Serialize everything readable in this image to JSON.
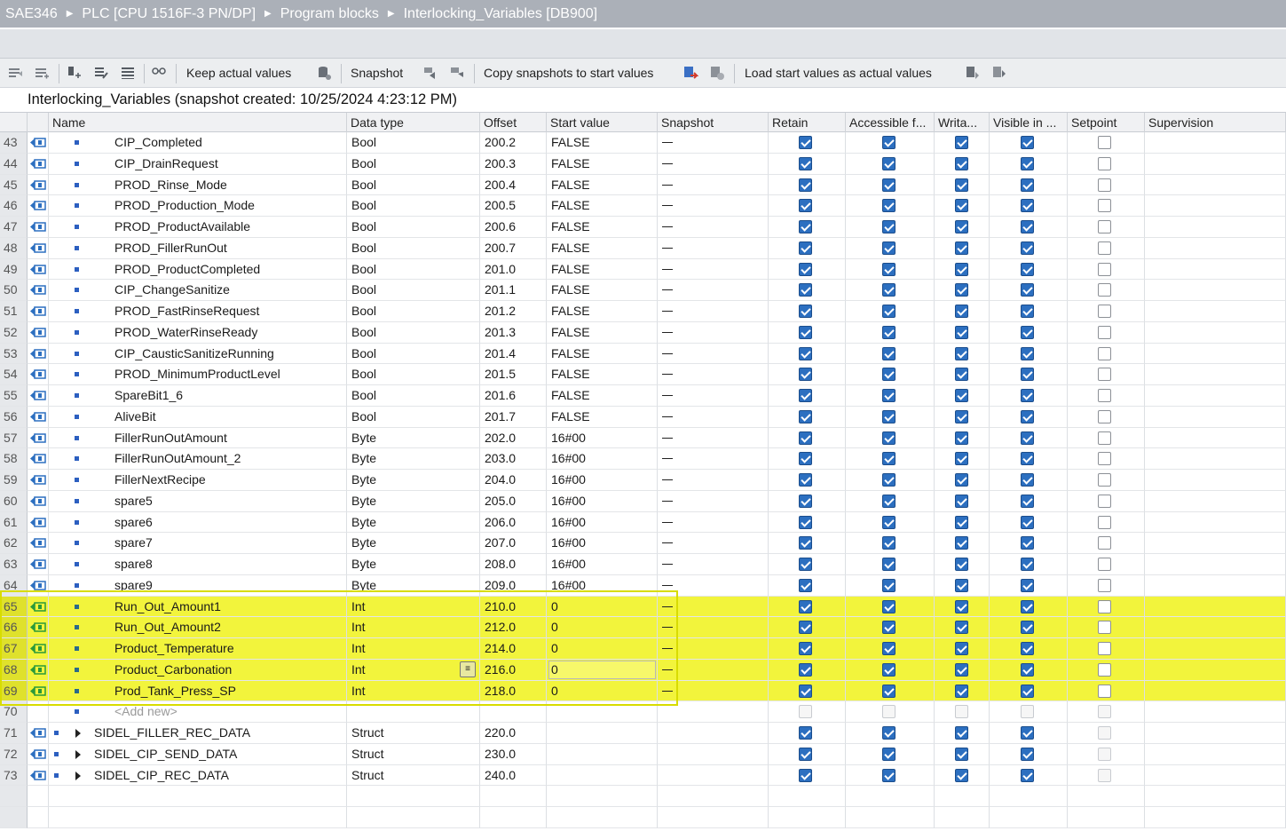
{
  "breadcrumb": [
    "SAE346",
    "PLC [CPU 1516F-3 PN/DP]",
    "Program blocks",
    "Interlocking_Variables [DB900]"
  ],
  "toolbar": {
    "keep_actual_values": "Keep actual values",
    "snapshot": "Snapshot",
    "copy_snapshots": "Copy snapshots to start values",
    "load_start_values": "Load start values as actual values"
  },
  "snapshot_title": "Interlocking_Variables (snapshot created: 10/25/2024 4:23:12 PM)",
  "columns": [
    "Name",
    "Data type",
    "Offset",
    "Start value",
    "Snapshot",
    "Retain",
    "Accessible f...",
    "Writa...",
    "Visible in ...",
    "Setpoint",
    "Supervision"
  ],
  "rows": [
    {
      "n": "43",
      "name": "CIP_Completed",
      "type": "Bool",
      "offset": "200.2",
      "start": "FALSE",
      "snap": "—"
    },
    {
      "n": "44",
      "name": "CIP_DrainRequest",
      "type": "Bool",
      "offset": "200.3",
      "start": "FALSE",
      "snap": "—"
    },
    {
      "n": "45",
      "name": "PROD_Rinse_Mode",
      "type": "Bool",
      "offset": "200.4",
      "start": "FALSE",
      "snap": "—"
    },
    {
      "n": "46",
      "name": "PROD_Production_Mode",
      "type": "Bool",
      "offset": "200.5",
      "start": "FALSE",
      "snap": "—"
    },
    {
      "n": "47",
      "name": "PROD_ProductAvailable",
      "type": "Bool",
      "offset": "200.6",
      "start": "FALSE",
      "snap": "—"
    },
    {
      "n": "48",
      "name": "PROD_FillerRunOut",
      "type": "Bool",
      "offset": "200.7",
      "start": "FALSE",
      "snap": "—"
    },
    {
      "n": "49",
      "name": "PROD_ProductCompleted",
      "type": "Bool",
      "offset": "201.0",
      "start": "FALSE",
      "snap": "—"
    },
    {
      "n": "50",
      "name": "CIP_ChangeSanitize",
      "type": "Bool",
      "offset": "201.1",
      "start": "FALSE",
      "snap": "—"
    },
    {
      "n": "51",
      "name": "PROD_FastRinseRequest",
      "type": "Bool",
      "offset": "201.2",
      "start": "FALSE",
      "snap": "—"
    },
    {
      "n": "52",
      "name": "PROD_WaterRinseReady",
      "type": "Bool",
      "offset": "201.3",
      "start": "FALSE",
      "snap": "—"
    },
    {
      "n": "53",
      "name": "CIP_CausticSanitizeRunning",
      "type": "Bool",
      "offset": "201.4",
      "start": "FALSE",
      "snap": "—"
    },
    {
      "n": "54",
      "name": "PROD_MinimumProductLevel",
      "type": "Bool",
      "offset": "201.5",
      "start": "FALSE",
      "snap": "—"
    },
    {
      "n": "55",
      "name": "SpareBit1_6",
      "type": "Bool",
      "offset": "201.6",
      "start": "FALSE",
      "snap": "—"
    },
    {
      "n": "56",
      "name": "AliveBit",
      "type": "Bool",
      "offset": "201.7",
      "start": "FALSE",
      "snap": "—"
    },
    {
      "n": "57",
      "name": "FillerRunOutAmount",
      "type": "Byte",
      "offset": "202.0",
      "start": "16#00",
      "snap": "—"
    },
    {
      "n": "58",
      "name": "FillerRunOutAmount_2",
      "type": "Byte",
      "offset": "203.0",
      "start": "16#00",
      "snap": "—"
    },
    {
      "n": "59",
      "name": "FillerNextRecipe",
      "type": "Byte",
      "offset": "204.0",
      "start": "16#00",
      "snap": "—"
    },
    {
      "n": "60",
      "name": "spare5",
      "type": "Byte",
      "offset": "205.0",
      "start": "16#00",
      "snap": "—"
    },
    {
      "n": "61",
      "name": "spare6",
      "type": "Byte",
      "offset": "206.0",
      "start": "16#00",
      "snap": "—"
    },
    {
      "n": "62",
      "name": "spare7",
      "type": "Byte",
      "offset": "207.0",
      "start": "16#00",
      "snap": "—"
    },
    {
      "n": "63",
      "name": "spare8",
      "type": "Byte",
      "offset": "208.0",
      "start": "16#00",
      "snap": "—"
    },
    {
      "n": "64",
      "name": "spare9",
      "type": "Byte",
      "offset": "209.0",
      "start": "16#00",
      "snap": "—"
    },
    {
      "n": "65",
      "name": "Run_Out_Amount1",
      "type": "Int",
      "offset": "210.0",
      "start": "0",
      "snap": "—",
      "hl": true
    },
    {
      "n": "66",
      "name": "Run_Out_Amount2",
      "type": "Int",
      "offset": "212.0",
      "start": "0",
      "snap": "—",
      "hl": true
    },
    {
      "n": "67",
      "name": "Product_Temperature",
      "type": "Int",
      "offset": "214.0",
      "start": "0",
      "snap": "—",
      "hl": true
    },
    {
      "n": "68",
      "name": "Product_Carbonation",
      "type": "Int",
      "offset": "216.0",
      "start": "0",
      "snap": "—",
      "hl": true,
      "editing": true
    },
    {
      "n": "69",
      "name": "Prod_Tank_Press_SP",
      "type": "Int",
      "offset": "218.0",
      "start": "0",
      "snap": "—",
      "hl": true
    },
    {
      "n": "70",
      "name": "<Add new>",
      "type": "",
      "offset": "",
      "start": "",
      "snap": "",
      "addnew": true
    },
    {
      "n": "71",
      "name": "SIDEL_FILLER_REC_DATA",
      "type": "Struct",
      "offset": "220.0",
      "start": "",
      "snap": "",
      "struct": true
    },
    {
      "n": "72",
      "name": "SIDEL_CIP_SEND_DATA",
      "type": "Struct",
      "offset": "230.0",
      "start": "",
      "snap": "",
      "struct": true
    },
    {
      "n": "73",
      "name": "SIDEL_CIP_REC_DATA",
      "type": "Struct",
      "offset": "240.0",
      "start": "",
      "snap": "",
      "struct": true
    }
  ],
  "colors": {
    "highlight": "#f2f43c",
    "checkbox": "#2c6fc0",
    "titlebar": "#abb0b8"
  }
}
